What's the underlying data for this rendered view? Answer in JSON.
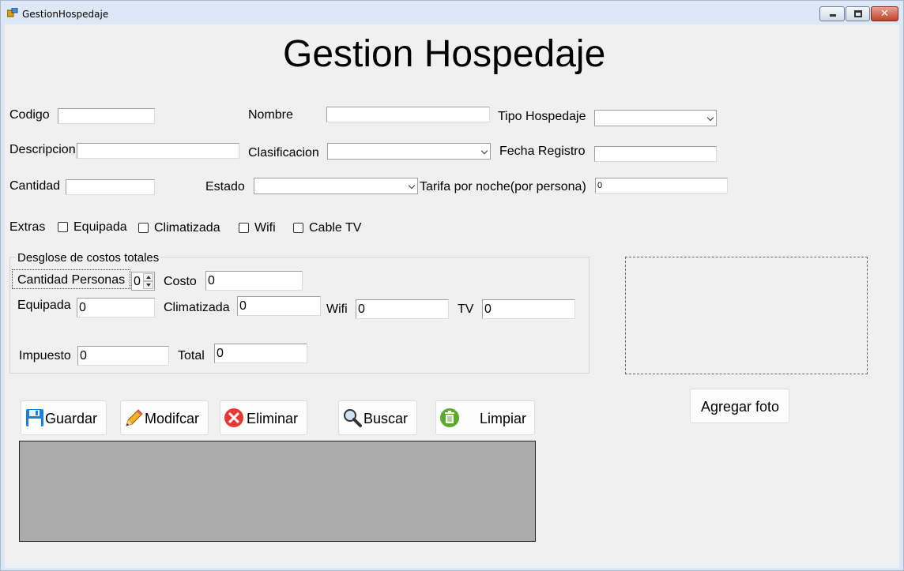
{
  "window": {
    "title": "GestionHospedaje"
  },
  "form": {
    "heading": "Gestion Hospedaje",
    "labels": {
      "codigo": "Codigo",
      "nombre": "Nombre",
      "tipo_hospedaje": "Tipo Hospedaje",
      "descripcion": "Descripcion",
      "clasificacion": "Clasificacion",
      "fecha_registro": "Fecha Registro",
      "cantidad": "Cantidad",
      "estado": "Estado",
      "tarifa": "Tarifa por noche(por persona)",
      "extras": "Extras"
    },
    "values": {
      "codigo": "",
      "nombre": "",
      "tipo_hospedaje": "",
      "descripcion": "",
      "clasificacion": "",
      "fecha_registro": "",
      "cantidad": "",
      "estado": "",
      "tarifa": "0"
    },
    "extras": [
      {
        "label": "Equipada",
        "checked": false
      },
      {
        "label": "Climatizada",
        "checked": false
      },
      {
        "label": "Wifi",
        "checked": false
      },
      {
        "label": "Cable TV",
        "checked": false
      }
    ]
  },
  "costs": {
    "group_title": "Desglose de costos totales",
    "cantidad_personas_label": "Cantidad Personas",
    "cantidad_personas_value": "0",
    "costo_label": "Costo",
    "costo_value": "0",
    "equipada_label": "Equipada",
    "equipada_value": "0",
    "climatizada_label": "Climatizada",
    "climatizada_value": "0",
    "wifi_label": "Wifi",
    "wifi_value": "0",
    "tv_label": "TV",
    "tv_value": "0",
    "impuesto_label": "Impuesto",
    "impuesto_value": "0",
    "total_label": "Total",
    "total_value": "0"
  },
  "photo": {
    "button_label": "Agregar foto"
  },
  "toolbar": {
    "guardar": "Guardar",
    "modificar": "Modifcar",
    "eliminar": "Eliminar",
    "buscar": "Buscar",
    "limpiar": "Limpiar"
  },
  "colors": {
    "form_bg": "#f0f0f0",
    "grid_bg": "#ababab",
    "save_blue": "#1e7fd6",
    "delete_red": "#e53935",
    "clear_green": "#5aaa2b"
  }
}
